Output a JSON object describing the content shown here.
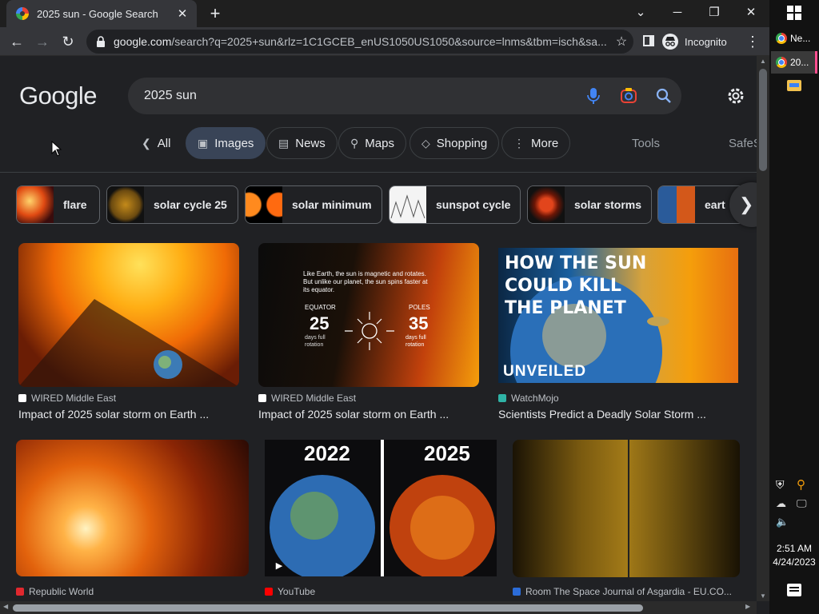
{
  "browser": {
    "tab_title": "2025 sun - Google Search",
    "url_host": "google.com",
    "url_rest": "/search?q=2025+sun&rlz=1C1GCEB_enUS1050US1050&source=lnms&tbm=isch&sa...",
    "profile_label": "Incognito"
  },
  "google": {
    "logo": "Google",
    "query": "2025 sun",
    "nav": [
      {
        "label": "All",
        "icon": "chevron-left-icon"
      },
      {
        "label": "Images",
        "icon": "image-icon"
      },
      {
        "label": "News",
        "icon": "news-icon"
      },
      {
        "label": "Maps",
        "icon": "map-pin-icon"
      },
      {
        "label": "Shopping",
        "icon": "tag-icon"
      },
      {
        "label": "More",
        "icon": "more-vert-icon"
      }
    ],
    "tools_label": "Tools",
    "safesearch_label": "SafeS",
    "chips": [
      "flare",
      "solar cycle 25",
      "solar minimum",
      "sunspot cycle",
      "solar storms",
      "eart"
    ],
    "results": [
      {
        "source": "WIRED Middle East",
        "caption": "Impact of 2025 solar storm on Earth ..."
      },
      {
        "source": "WIRED Middle East",
        "caption": "Impact of 2025 solar storm on Earth ..."
      },
      {
        "source": "WatchMojo",
        "caption": "Scientists Predict a Deadly Solar Storm ..."
      },
      {
        "source": "Republic World",
        "caption": ""
      },
      {
        "source": "YouTube",
        "caption": ""
      },
      {
        "source": "Room The Space Journal of Asgardia - EU.CO...",
        "caption": ""
      }
    ],
    "infographic": {
      "text": "Like Earth, the sun is magnetic and rotates. But unlike our planet, the sun spins faster at its equator.",
      "equator_label": "EQUATOR",
      "equator_value": "25",
      "poles_label": "POLES",
      "poles_value": "35",
      "unit": "days full rotation"
    },
    "watchmojo_title": [
      "HOW THE SUN",
      "COULD KILL",
      "THE PLANET"
    ],
    "watchmojo_sub": "UNVEILED",
    "year_left": "2022",
    "year_right": "2025"
  },
  "taskbar": {
    "tasks": [
      "Ne...",
      "20..."
    ],
    "time": "2:51 AM",
    "date": "4/24/2023"
  },
  "colors": {
    "accent": "#8ab4f8",
    "active_chip": "#394457",
    "pink": "#ff4d8f"
  }
}
